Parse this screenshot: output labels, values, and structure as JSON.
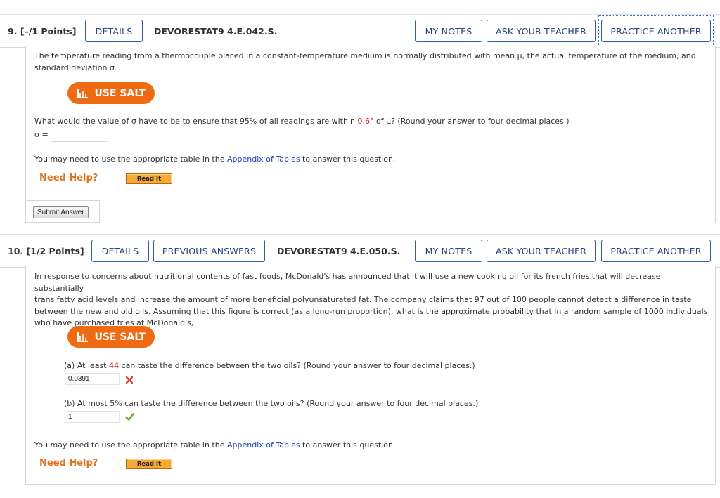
{
  "q9": {
    "number": "9.",
    "points": "[–/1 Points]",
    "details": "DETAILS",
    "code": "DEVORESTAT9 4.E.042.S.",
    "my_notes": "MY NOTES",
    "ask_teacher": "ASK YOUR TEACHER",
    "practice_another": "PRACTICE ANOTHER",
    "intro_line1": "The temperature reading from a thermocouple placed in a constant-temperature medium is normally distributed with mean μ, the actual temperature of the medium, and",
    "intro_line2": "standard deviation σ.",
    "salt_label": "USE SALT",
    "question_pre": "What would the value of σ have to be to ensure that 95% of all readings are within ",
    "question_highlight": "0.6°",
    "question_post": " of μ? (Round your answer to four decimal places.)",
    "sigma_label": "σ =",
    "sigma_value": "",
    "table_pre": "You may need to use the appropriate table in the ",
    "table_link": "Appendix of Tables",
    "table_post": " to answer this question.",
    "need_help": "Need Help?",
    "read_it": "Read It",
    "submit": "Submit Answer"
  },
  "q10": {
    "number": "10.",
    "points": "[1/2 Points]",
    "details": "DETAILS",
    "previous_answers": "PREVIOUS ANSWERS",
    "code": "DEVORESTAT9 4.E.050.S.",
    "my_notes": "MY NOTES",
    "ask_teacher": "ASK YOUR TEACHER",
    "practice_another": "PRACTICE ANOTHER",
    "intro_line1": "In response to concerns about nutritional contents of fast foods, McDonald's has announced that it will use a new cooking oil for its french fries that will decrease substantially",
    "intro_line2": "trans fatty acid levels and increase the amount of more beneficial polyunsaturated fat. The company claims that 97 out of 100 people cannot detect a difference in taste",
    "intro_line3": "between the new and old oils. Assuming that this figure is correct (as a long-run proportion), what is the approximate probability that in a random sample of 1000 individuals",
    "intro_line4": "who have purchased fries at McDonald's,",
    "salt_label": "USE SALT",
    "part_a_pre": "(a) At least ",
    "part_a_highlight": "44",
    "part_a_post": " can taste the difference between the two oils? (Round your answer to four decimal places.)",
    "part_a_value": "0.0391",
    "part_b": "(b) At most 5% can taste the difference between the two oils? (Round your answer to four decimal places.)",
    "part_b_value": "1",
    "table_pre": "You may need to use the appropriate table in the ",
    "table_link": "Appendix of Tables",
    "table_post": " to answer this question.",
    "need_help": "Need Help?",
    "read_it": "Read It"
  },
  "colors": {
    "accent": "#ee6a13",
    "button_border": "#2f5f9e",
    "highlight_red": "#c62828",
    "link_blue": "#1a3fb8",
    "correct_green": "#5aa832",
    "incorrect_red": "#e0403a"
  }
}
